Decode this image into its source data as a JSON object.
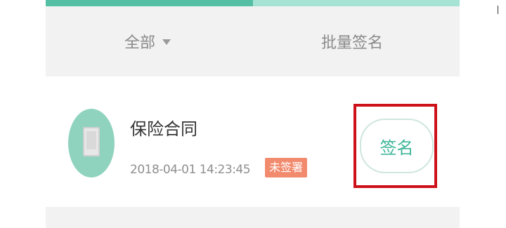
{
  "progress": {
    "value_percent": 50,
    "fill_color": "#55bfa6",
    "track_color": "#a6e3d4"
  },
  "filter_bar": {
    "all_label": "全部",
    "dropdown_icon": "caret-down-icon",
    "batch_sign_label": "批量签名"
  },
  "document_item": {
    "avatar_icon": "document-icon",
    "title": "保险合同",
    "datetime": "2018-04-01 14:23:45",
    "status_badge": "未签署",
    "status_badge_color": "#f28b6e",
    "sign_button_label": "签名",
    "sign_button_text_color": "#3fb59a",
    "highlight_color": "#cc1119"
  }
}
